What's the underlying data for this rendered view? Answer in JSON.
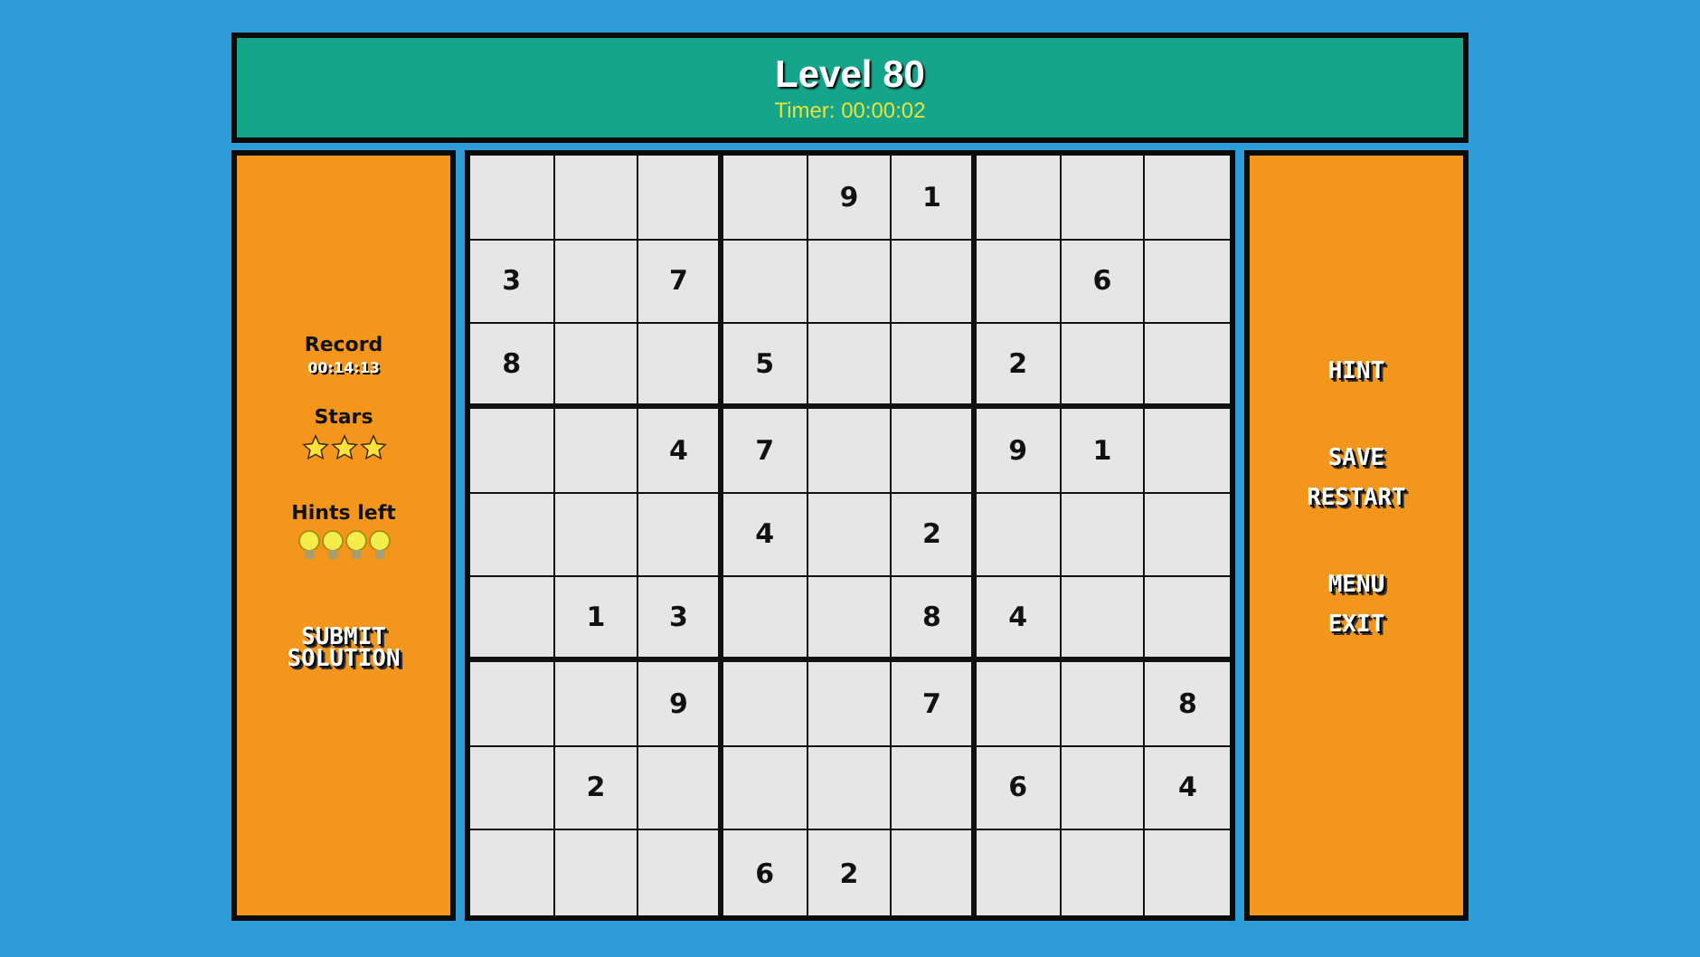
{
  "header": {
    "title": "Level 80",
    "timer": "Timer: 00:00:02"
  },
  "left_panel": {
    "record_label": "Record",
    "record_time": "00:14:13",
    "stars_label": "Stars",
    "stars": 3,
    "hints_label": "Hints left",
    "hint_bulbs": [
      {
        "lit": true
      },
      {
        "lit": true
      },
      {
        "lit": true
      },
      {
        "lit": true
      }
    ],
    "submit_lines": [
      "SUBMIT",
      "SOLUTION"
    ]
  },
  "grid": [
    [
      {
        "kind": "empty"
      },
      {
        "kind": "empty"
      },
      {
        "kind": "empty"
      },
      {
        "kind": "empty"
      },
      {
        "kind": "given",
        "digit": "9"
      },
      {
        "kind": "given",
        "digit": "1"
      },
      {
        "kind": "empty"
      },
      {
        "kind": "empty"
      },
      {
        "kind": "empty"
      }
    ],
    [
      {
        "kind": "given",
        "digit": "3"
      },
      {
        "kind": "empty"
      },
      {
        "kind": "given",
        "digit": "7"
      },
      {
        "kind": "empty"
      },
      {
        "kind": "empty"
      },
      {
        "kind": "empty"
      },
      {
        "kind": "empty"
      },
      {
        "kind": "given",
        "digit": "6"
      },
      {
        "kind": "empty"
      }
    ],
    [
      {
        "kind": "given",
        "digit": "8"
      },
      {
        "kind": "empty"
      },
      {
        "kind": "empty"
      },
      {
        "kind": "given",
        "digit": "5"
      },
      {
        "kind": "empty"
      },
      {
        "kind": "empty"
      },
      {
        "kind": "given",
        "digit": "2"
      },
      {
        "kind": "empty"
      },
      {
        "kind": "empty"
      }
    ],
    [
      {
        "kind": "empty"
      },
      {
        "kind": "empty"
      },
      {
        "kind": "given",
        "digit": "4"
      },
      {
        "kind": "given",
        "digit": "7"
      },
      {
        "kind": "empty"
      },
      {
        "kind": "empty"
      },
      {
        "kind": "given",
        "digit": "9"
      },
      {
        "kind": "given",
        "digit": "1"
      },
      {
        "kind": "empty"
      }
    ],
    [
      {
        "kind": "empty"
      },
      {
        "kind": "empty"
      },
      {
        "kind": "empty"
      },
      {
        "kind": "given",
        "digit": "4"
      },
      {
        "kind": "empty"
      },
      {
        "kind": "given",
        "digit": "2"
      },
      {
        "kind": "empty"
      },
      {
        "kind": "empty"
      },
      {
        "kind": "empty"
      }
    ],
    [
      {
        "kind": "empty"
      },
      {
        "kind": "given",
        "digit": "1"
      },
      {
        "kind": "given",
        "digit": "3"
      },
      {
        "kind": "empty"
      },
      {
        "kind": "empty"
      },
      {
        "kind": "given",
        "digit": "8"
      },
      {
        "kind": "given",
        "digit": "4"
      },
      {
        "kind": "empty"
      },
      {
        "kind": "empty"
      }
    ],
    [
      {
        "kind": "empty"
      },
      {
        "kind": "empty"
      },
      {
        "kind": "given",
        "digit": "9"
      },
      {
        "kind": "empty"
      },
      {
        "kind": "empty"
      },
      {
        "kind": "given",
        "digit": "7"
      },
      {
        "kind": "empty"
      },
      {
        "kind": "empty"
      },
      {
        "kind": "given",
        "digit": "8"
      }
    ],
    [
      {
        "kind": "empty"
      },
      {
        "kind": "given",
        "digit": "2"
      },
      {
        "kind": "empty"
      },
      {
        "kind": "empty"
      },
      {
        "kind": "empty"
      },
      {
        "kind": "empty"
      },
      {
        "kind": "given",
        "digit": "6"
      },
      {
        "kind": "empty"
      },
      {
        "kind": "given",
        "digit": "4"
      }
    ],
    [
      {
        "kind": "empty"
      },
      {
        "kind": "empty"
      },
      {
        "kind": "empty"
      },
      {
        "kind": "given",
        "digit": "6"
      },
      {
        "kind": "given",
        "digit": "2"
      },
      {
        "kind": "empty"
      },
      {
        "kind": "empty"
      },
      {
        "kind": "empty"
      },
      {
        "kind": "empty"
      }
    ]
  ],
  "right_panel": {
    "groups": [
      [
        "HINT"
      ],
      [
        "SAVE",
        "RESTART"
      ],
      [
        "MENU",
        "EXIT"
      ]
    ]
  }
}
